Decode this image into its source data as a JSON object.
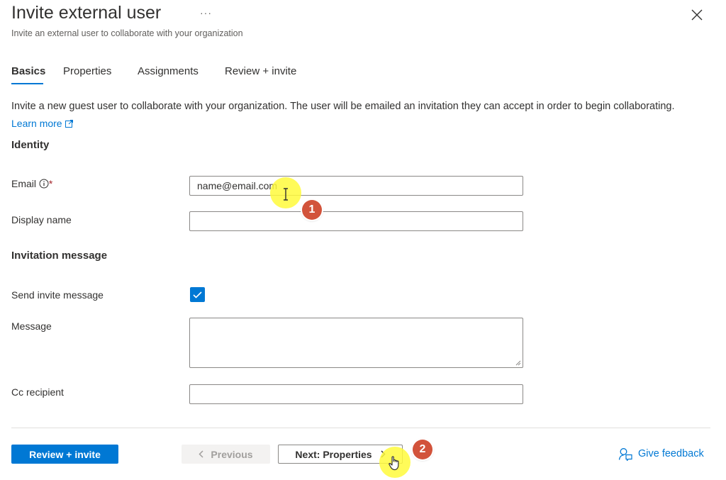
{
  "header": {
    "title": "Invite external user",
    "more": "···",
    "subtitle": "Invite an external user to collaborate with your organization"
  },
  "tabs": [
    {
      "label": "Basics",
      "active": true
    },
    {
      "label": "Properties",
      "active": false
    },
    {
      "label": "Assignments",
      "active": false
    },
    {
      "label": "Review + invite",
      "active": false
    }
  ],
  "intro": {
    "description": "Invite a new guest user to collaborate with your organization. The user will be emailed an invitation they can accept in order to begin collaborating.",
    "learn_more": "Learn more"
  },
  "identity": {
    "heading": "Identity",
    "email_label": "Email",
    "required_mark": "*",
    "email_value": "name@email.com",
    "display_name_label": "Display name",
    "display_name_value": ""
  },
  "invitation": {
    "heading": "Invitation message",
    "send_invite_label": "Send invite message",
    "send_invite_checked": true,
    "message_label": "Message",
    "message_value": "",
    "cc_label": "Cc recipient",
    "cc_value": ""
  },
  "footer": {
    "review_invite": "Review + invite",
    "previous": "Previous",
    "next": "Next: Properties",
    "feedback": "Give feedback"
  },
  "annotations": {
    "step1": "1",
    "step2": "2",
    "highlight_color": "#fff93c",
    "marker_color": "#d2533b"
  },
  "colors": {
    "accent": "#0078d4",
    "text": "#323130"
  }
}
